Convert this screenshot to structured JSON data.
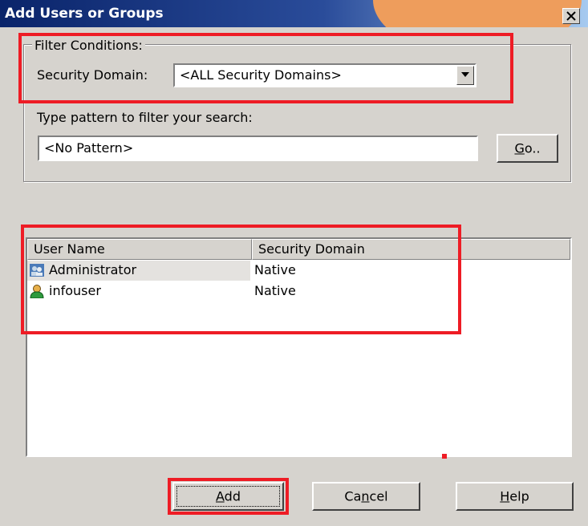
{
  "window": {
    "title": "Add Users or Groups"
  },
  "filter": {
    "legend": "Filter Conditions:",
    "security_domain_label": "Security Domain:",
    "security_domain_value": "<ALL Security Domains>",
    "pattern_label": "Type pattern to filter your search:",
    "pattern_value": "<No Pattern>",
    "go_label": "Go.."
  },
  "list": {
    "columns": [
      "User Name",
      "Security Domain"
    ],
    "rows": [
      {
        "user": "Administrator",
        "domain": "Native",
        "icon": "group-icon"
      },
      {
        "user": "infouser",
        "domain": "Native",
        "icon": "user-icon"
      }
    ]
  },
  "buttons": {
    "add": "Add",
    "cancel": "Cancel",
    "help": "Help"
  },
  "colors": {
    "annotation": "#ee1c25",
    "titlebar": "#0a246a",
    "dialog": "#d6d3ce"
  }
}
